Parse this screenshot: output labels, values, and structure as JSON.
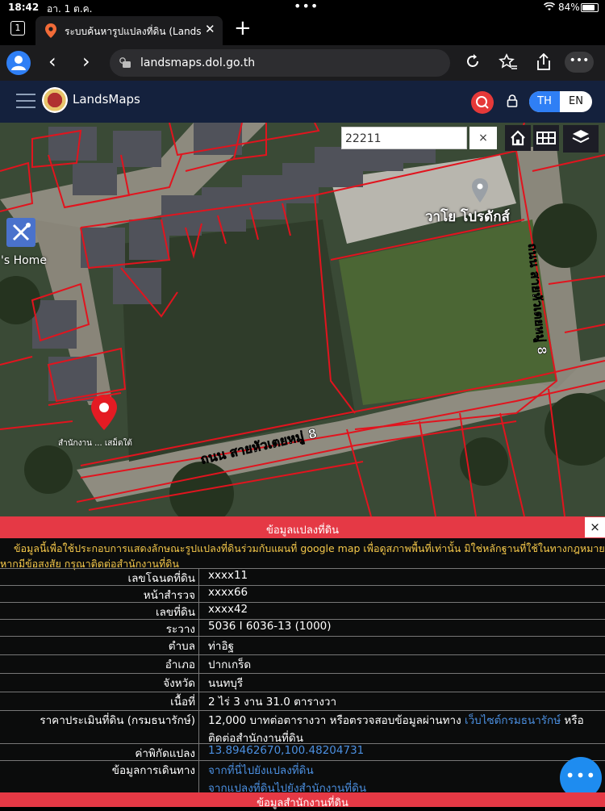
{
  "status": {
    "time": "18:42",
    "date": "อา. 1 ต.ค.",
    "battery": "84%",
    "battery_level": 0.84
  },
  "tab": {
    "count": "1",
    "title": "ระบบค้นหารูปแปลงที่ดิน (LandsMaps)"
  },
  "url": "landsmaps.dol.go.th",
  "header": {
    "brand": "LandsMaps",
    "lang_th": "TH",
    "lang_en": "EN",
    "active_lang": "TH"
  },
  "map": {
    "search_value": "22211",
    "clear_label": "×",
    "place_label": "วาโย โปรดักส์",
    "home_label": "'s Home",
    "marker_label": "สำนักงาน ... เสม็ดใต้",
    "road_label_1": "ถนน สายหัวเตยหมู่ 8",
    "road_label_2": "ถนน สายหัวเตยหมู่ 8"
  },
  "panel": {
    "title": "ข้อมูลแปลงที่ดิน",
    "close": "×",
    "notice": "ข้อมูลนี้เพื่อใช้ประกอบการแสดงลักษณะรูปแปลงที่ดินร่วมกับแผนที่ google map เพื่อดูสภาพพื้นที่เท่านั้น มิใช่หลักฐานที่ใช้ในทางกฎหมาย หากมีข้อสงสัย กรุณาติดต่อสำนักงานที่ดิน",
    "rows": [
      {
        "label": "เลขโฉนดที่ดิน",
        "value": "xxxx11"
      },
      {
        "label": "หน้าสำรวจ",
        "value": "xxxx66"
      },
      {
        "label": "เลขที่ดิน",
        "value": "xxxx42"
      },
      {
        "label": "ระวาง",
        "value": "5036 I 6036-13 (1000)"
      },
      {
        "label": "ตำบล",
        "value": "ท่าอิฐ"
      },
      {
        "label": "อำเภอ",
        "value": "ปากเกร็ด"
      },
      {
        "label": "จังหวัด",
        "value": "นนทบุรี"
      },
      {
        "label": "เนื้อที่",
        "value": "2 ไร่ 3 งาน 31.0 ตารางวา"
      }
    ],
    "price": {
      "label": "ราคาประเมินที่ดิน (กรมธนารักษ์)",
      "text_before": "12,000 บาทต่อตารางวา หรือตรวจสอบข้อมูลผ่านทาง ",
      "link": "เว็บไซต์กรมธนารักษ์",
      "text_after": " หรือติดต่อสำนักงานที่ดิน"
    },
    "coords": {
      "label": "ค่าพิกัดแปลง",
      "value": "13.89462670,100.48204731"
    },
    "travel": {
      "label": "ข้อมูลการเดินทาง",
      "link1": "จากที่นี่ไปยังแปลงที่ดิน",
      "link2": "จากแปลงที่ดินไปยังสำนักงานที่ดิน"
    }
  },
  "panel2": {
    "title": "ข้อมูลสำนักงานที่ดิน"
  },
  "fab": {
    "label": "•••"
  },
  "icons": [
    "tab-count-icon",
    "map-pin-favicon",
    "close-icon",
    "plus-icon",
    "profile-icon",
    "back-icon",
    "forward-icon",
    "site-settings-icon",
    "reload-icon",
    "favorites-icon",
    "share-icon",
    "more-icon",
    "menu-icon",
    "search-icon",
    "lock-icon",
    "home-icon",
    "grid-icon",
    "layers-icon",
    "tools-icon",
    "location-pin-icon"
  ]
}
